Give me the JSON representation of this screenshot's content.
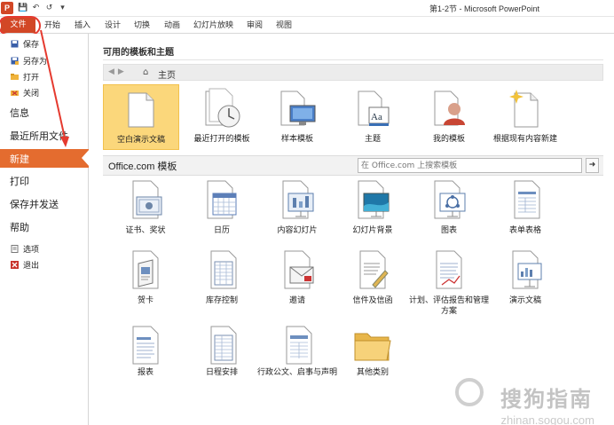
{
  "window": {
    "title": "第1-2节 - Microsoft PowerPoint",
    "app_icon_letter": "P"
  },
  "ribbon": {
    "file_tab": "文件",
    "tabs": [
      "开始",
      "插入",
      "设计",
      "切换",
      "动画",
      "幻灯片放映",
      "审阅",
      "视图"
    ]
  },
  "backstage_nav": {
    "save": "保存",
    "save_as": "另存为",
    "open": "打开",
    "close": "关闭",
    "info": "信息",
    "recent": "最近所用文件",
    "new": "新建",
    "print": "打印",
    "save_send": "保存并发送",
    "help": "帮助",
    "options": "选项",
    "exit": "退出"
  },
  "main": {
    "section_title": "可用的模板和主题",
    "breadcrumb_home": "主页",
    "top_tiles": [
      {
        "label": "空白演示文稿",
        "icon": "blank-doc-icon",
        "selected": true
      },
      {
        "label": "最近打开的模板",
        "icon": "recent-clock-icon"
      },
      {
        "label": "样本模板",
        "icon": "sample-monitor-icon"
      },
      {
        "label": "主题",
        "icon": "theme-aa-icon"
      },
      {
        "label": "我的模板",
        "icon": "user-avatar-icon"
      },
      {
        "label": "根据现有内容新建",
        "icon": "sparkle-doc-icon"
      }
    ],
    "office_label": "Office.com 模板",
    "search_placeholder": "在 Office.com 上搜索模板",
    "office_tiles": [
      {
        "label": "证书、奖状",
        "icon": "certificate-icon"
      },
      {
        "label": "日历",
        "icon": "calendar-icon"
      },
      {
        "label": "内容幻灯片",
        "icon": "slide-content-icon"
      },
      {
        "label": "幻灯片背景",
        "icon": "slide-background-icon"
      },
      {
        "label": "图表",
        "icon": "diagram-icon"
      },
      {
        "label": "表单表格",
        "icon": "form-icon"
      },
      {
        "label": "贺卡",
        "icon": "greeting-card-icon"
      },
      {
        "label": "库存控制",
        "icon": "inventory-icon"
      },
      {
        "label": "邀请",
        "icon": "invitation-icon"
      },
      {
        "label": "信件及信函",
        "icon": "letter-icon"
      },
      {
        "label": "计划、评估报告和管理方案",
        "icon": "plan-icon"
      },
      {
        "label": "演示文稿",
        "icon": "presentation-icon"
      },
      {
        "label": "报表",
        "icon": "report-icon"
      },
      {
        "label": "日程安排",
        "icon": "schedule-icon"
      },
      {
        "label": "行政公文、启事与声明",
        "icon": "notice-icon"
      },
      {
        "label": "其他类别",
        "icon": "folder-icon"
      }
    ]
  },
  "watermark": {
    "text": "搜狗指南",
    "sub": "zhinan.sogou.com"
  },
  "colors": {
    "file_tab": "#d24726",
    "nav_active": "#e46c2f",
    "selected_tile": "#fbd77b",
    "annotation": "#e53a2f"
  }
}
